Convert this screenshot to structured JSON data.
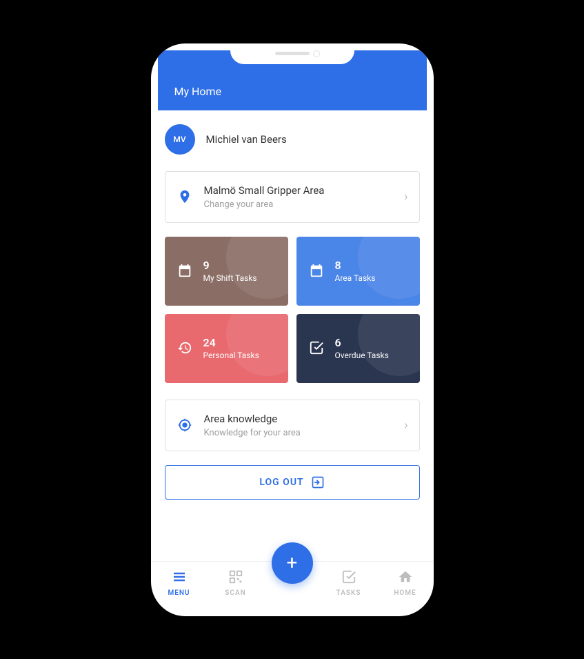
{
  "header": {
    "title": "My Home"
  },
  "user": {
    "initials": "MV",
    "name": "Michiel van Beers"
  },
  "area_card": {
    "title": "Malmö Small Gripper Area",
    "subtitle": "Change your area"
  },
  "tiles": [
    {
      "count": "9",
      "label": "My Shift Tasks",
      "color": "brown",
      "icon": "calendar"
    },
    {
      "count": "8",
      "label": "Area Tasks",
      "color": "blue",
      "icon": "calendar"
    },
    {
      "count": "24",
      "label": "Personal Tasks",
      "color": "red",
      "icon": "history"
    },
    {
      "count": "6",
      "label": "Overdue Tasks",
      "color": "dark",
      "icon": "checkbox"
    }
  ],
  "knowledge_card": {
    "title": "Area knowledge",
    "subtitle": "Knowledge for your area"
  },
  "logout": {
    "label": "LOG OUT"
  },
  "nav": {
    "items": [
      {
        "label": "MENU",
        "active": true
      },
      {
        "label": "SCAN",
        "active": false
      },
      {
        "label": "TASKS",
        "active": false
      },
      {
        "label": "HOME",
        "active": false
      }
    ]
  },
  "colors": {
    "primary": "#2e6ee6",
    "brown": "#8a6e66",
    "blue": "#4a85e8",
    "red": "#e8696e",
    "dark": "#2a3550"
  }
}
